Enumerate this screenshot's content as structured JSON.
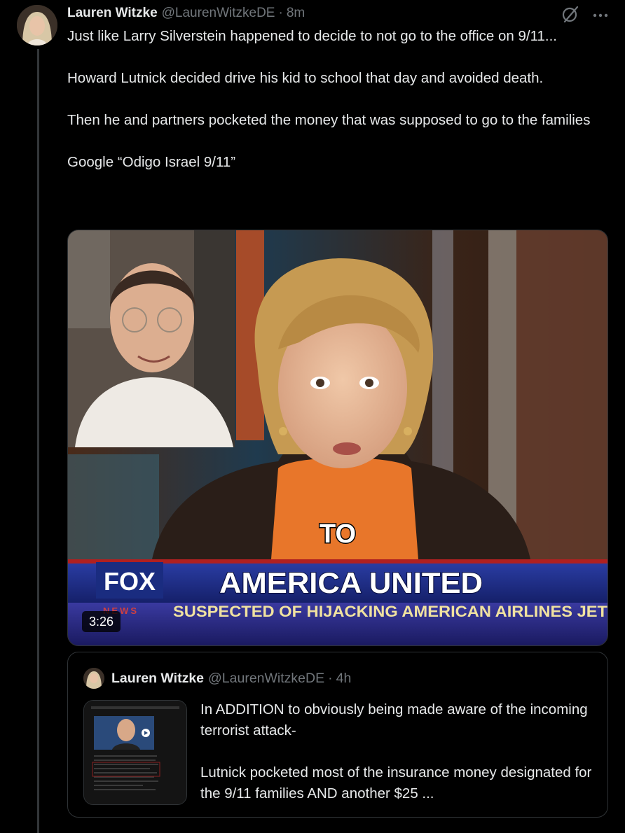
{
  "tweet": {
    "author_name": "Lauren Witzke",
    "handle": "@LaurenWitzkeDE",
    "separator": "·",
    "time": "8m",
    "more_icon": "more-horizontal-icon",
    "grok_icon": "grok-slash-icon",
    "paragraphs": [
      "Just like Larry Silverstein happened to decide to not go to the office on 9/11...",
      "Howard Lutnick decided drive his kid to school that day and avoided death.",
      "Then he and partners pocketed the money that was supposed to go to the families",
      "Google “Odigo Israel 9/11”"
    ]
  },
  "video": {
    "duration": "3:26",
    "caption_word": "TO",
    "network_logo": "FOX",
    "network_sub": "NEWS",
    "banner_title": "AMERICA UNITED",
    "ticker": "SUSPECTED OF HIJACKING AMERICAN AIRLINES JET"
  },
  "quote": {
    "author_name": "Lauren Witzke",
    "handle": "@LaurenWitzkeDE",
    "separator": "·",
    "time": "4h",
    "paragraphs": [
      "In ADDITION to obviously being made aware of the incoming terrorist attack-",
      "Lutnick pocketed most of the insurance money designated for the 9/11 families AND another $25 ..."
    ]
  },
  "colors": {
    "background": "#000000",
    "text": "#e7e9ea",
    "secondary": "#71767b",
    "border": "#2f3336",
    "thread_line": "#333639"
  }
}
